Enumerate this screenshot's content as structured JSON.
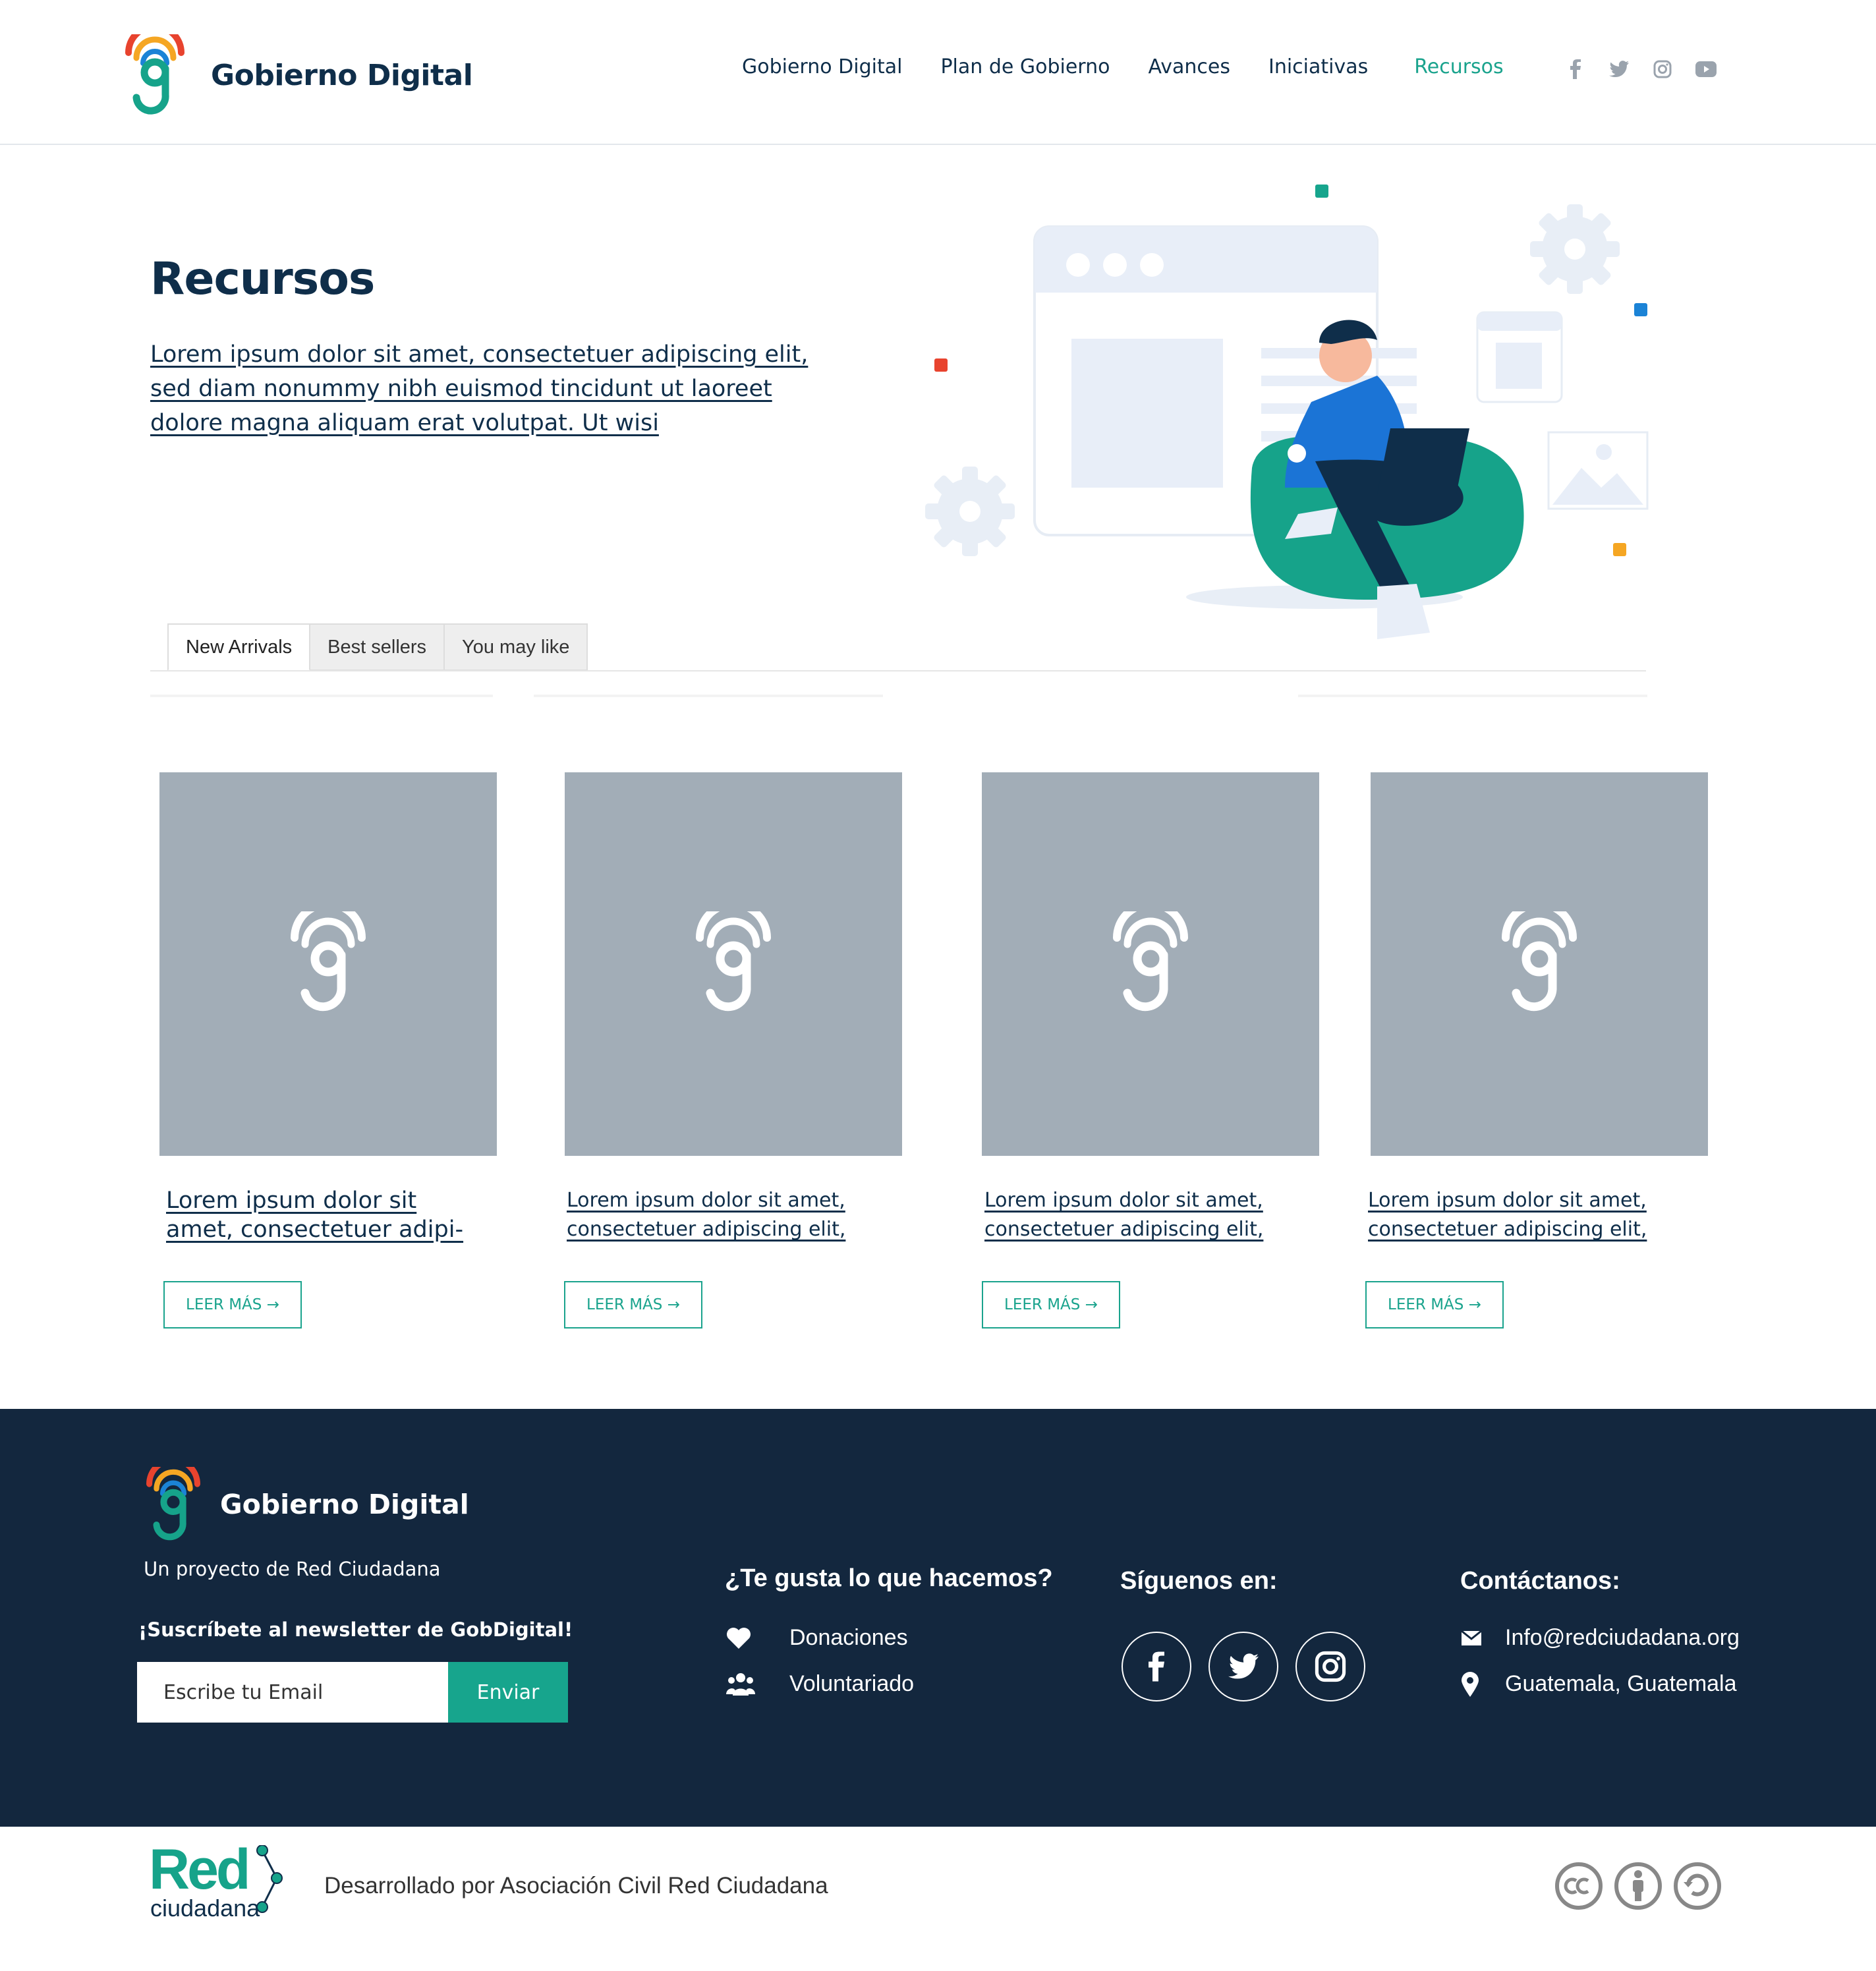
{
  "header": {
    "brand": "Gobierno Digital",
    "nav": [
      {
        "label": "Gobierno Digital",
        "active": false
      },
      {
        "label": "Plan de Gobierno",
        "active": false
      },
      {
        "label": "Avances",
        "active": false
      },
      {
        "label": "Iniciativas",
        "active": false
      },
      {
        "label": "Recursos",
        "active": true
      }
    ],
    "social": [
      "facebook-icon",
      "twitter-icon",
      "instagram-icon",
      "youtube-icon"
    ]
  },
  "hero": {
    "title": "Recursos",
    "description": "Lorem ipsum dolor sit amet, consectetuer adipiscing elit, sed diam nonummy nibh euismod tincidunt ut laoreet dolore magna aliquam erat volutpat. Ut wisi "
  },
  "tabs": [
    {
      "label": "New Arrivals",
      "selected": true
    },
    {
      "label": "Best sellers",
      "selected": false
    },
    {
      "label": "You may like",
      "selected": false
    }
  ],
  "cards": [
    {
      "line1": "Lorem ipsum dolor sit",
      "line2": "amet, consectetuer adipi-",
      "button": "LEER MÁS →"
    },
    {
      "line1": "Lorem ipsum dolor sit amet,",
      "line2": "consectetuer adipiscing elit,",
      "button": "LEER MÁS →"
    },
    {
      "line1": "Lorem ipsum dolor sit amet,",
      "line2": "consectetuer adipiscing elit,",
      "button": "LEER MÁS →"
    },
    {
      "line1": "Lorem ipsum dolor sit amet,",
      "line2": "consectetuer adipiscing elit,",
      "button": "LEER MÁS →"
    }
  ],
  "footer": {
    "brand": "Gobierno Digital",
    "tagline": "Un proyecto de Red Ciudadana",
    "newsletter_label": "¡Suscríbete al newsletter de GobDigital!",
    "email_placeholder": "Escribe tu Email",
    "send_label": "Enviar",
    "support_heading": "¿Te gusta lo que hacemos?",
    "support_links": [
      {
        "icon": "heart-icon",
        "label": "Donaciones"
      },
      {
        "icon": "people-icon",
        "label": "Voluntariado"
      }
    ],
    "follow_heading": "Síguenos en:",
    "follow_icons": [
      "facebook-icon",
      "twitter-icon",
      "instagram-icon"
    ],
    "contact_heading": "Contáctanos:",
    "contact": [
      {
        "icon": "envelope-icon",
        "label": "Info@redciudadana.org"
      },
      {
        "icon": "location-pin-icon",
        "label": "Guatemala, Guatemala"
      }
    ]
  },
  "bottom": {
    "logo_word": "Red",
    "logo_sub": "ciudadana",
    "developed_by": "Desarrollado por Asociación Civil Red Ciudadana",
    "license_icons": [
      "cc-icon",
      "by-icon",
      "sa-icon"
    ]
  },
  "colors": {
    "navy": "#0f2e4a",
    "teal": "#1aa38d",
    "footer_bg": "#13273e",
    "placeholder_gray": "#a2adb7"
  }
}
